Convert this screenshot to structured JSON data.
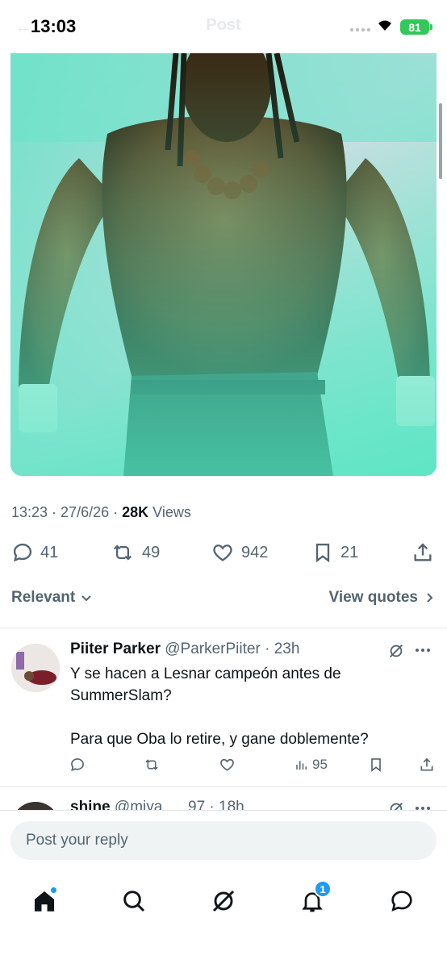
{
  "status_bar": {
    "time": "13:03",
    "battery": "81"
  },
  "header": {
    "title": "Post"
  },
  "post": {
    "time": "13:23",
    "date": "27/6/26",
    "views_count": "28K",
    "views_label": "Views",
    "stats": {
      "replies": "41",
      "reposts": "49",
      "likes": "942",
      "bookmarks": "21"
    }
  },
  "filters": {
    "relevant_label": "Relevant",
    "view_quotes_label": "View quotes"
  },
  "replies": [
    {
      "name": "Piiter Parker",
      "handle": "@ParkerPiiter",
      "time": "23h",
      "text_line1": "Y se hacen a Lesnar campeón antes de SummerSlam?",
      "text_line2": "Para que Oba lo retire, y gane doblemente?",
      "views": "95"
    },
    {
      "name": "shine",
      "handle": "@miya___97",
      "time": "18h"
    }
  ],
  "composer": {
    "placeholder": "Post your reply"
  },
  "tabs": {
    "notifications_badge": "1"
  },
  "colors": {
    "accent": "#1d9bf0",
    "secondary_text": "#536471",
    "battery": "#34c759"
  },
  "icons": [
    "back-arrow-icon",
    "wifi-icon",
    "reply-icon",
    "repost-icon",
    "like-icon",
    "bookmark-icon",
    "share-icon",
    "chevron-down-icon",
    "chevron-right-icon",
    "grok-icon",
    "more-icon",
    "views-icon",
    "home-icon",
    "search-icon",
    "notifications-icon",
    "messages-icon"
  ]
}
